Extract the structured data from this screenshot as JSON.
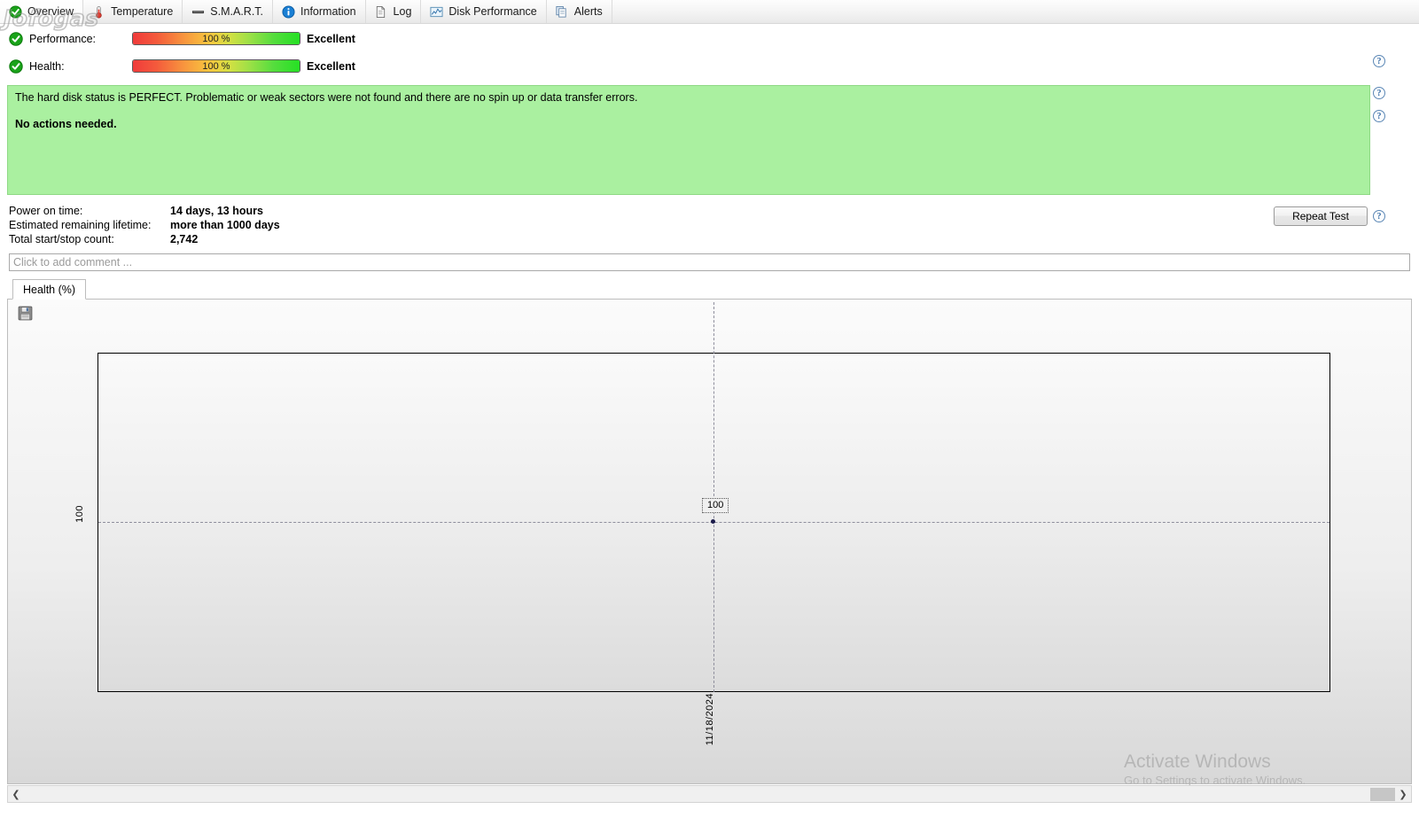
{
  "tabs": [
    {
      "label": "Overview",
      "icon": "check-circle-icon",
      "active": true
    },
    {
      "label": "Temperature",
      "icon": "thermometer-icon",
      "active": false
    },
    {
      "label": "S.M.A.R.T.",
      "icon": "smart-bar-icon",
      "active": false
    },
    {
      "label": "Information",
      "icon": "info-circle-icon",
      "active": false
    },
    {
      "label": "Log",
      "icon": "document-icon",
      "active": false
    },
    {
      "label": "Disk Performance",
      "icon": "chart-icon",
      "active": false
    },
    {
      "label": "Alerts",
      "icon": "copy-document-icon",
      "active": false
    }
  ],
  "status": {
    "performance": {
      "label": "Performance:",
      "percent_text": "100 %",
      "percent_value": 100,
      "rating": "Excellent"
    },
    "health": {
      "label": "Health:",
      "percent_text": "100 %",
      "percent_value": 100,
      "rating": "Excellent"
    }
  },
  "message": {
    "line1": "The hard disk status is PERFECT. Problematic or weak sectors were not found and there are no spin up or data transfer errors.",
    "line2": "No actions needed.",
    "background_color": "#aaf0a0"
  },
  "info": {
    "rows": [
      {
        "key": "Power on time:",
        "value": "14 days, 13 hours"
      },
      {
        "key": "Estimated remaining lifetime:",
        "value": "more than 1000 days"
      },
      {
        "key": "Total start/stop count:",
        "value": "2,742"
      }
    ]
  },
  "actions": {
    "repeat_test": "Repeat Test",
    "help_glyph": "?"
  },
  "comment": {
    "placeholder": "Click to add comment ...",
    "value": ""
  },
  "chart_panel": {
    "tab_label": "Health (%)",
    "save_icon": "floppy-save-icon"
  },
  "chart_data": {
    "type": "scatter",
    "title": "Health (%)",
    "xlabel": "",
    "ylabel": "",
    "x": [
      "11/18/2024"
    ],
    "values": [
      100
    ],
    "point_labels": [
      "100"
    ],
    "y_tick_labels": [
      "100"
    ],
    "x_tick_labels": [
      "11/18/2024"
    ],
    "ylim": [
      0,
      100
    ],
    "grid": true,
    "legend": "none"
  },
  "scrollbar": {
    "left_arrow": "❮",
    "right_arrow": "❯"
  },
  "watermarks": {
    "activate_line1": "Activate Windows",
    "activate_line2": "Go to Settings to activate Windows.",
    "brand": "Jofogas"
  }
}
